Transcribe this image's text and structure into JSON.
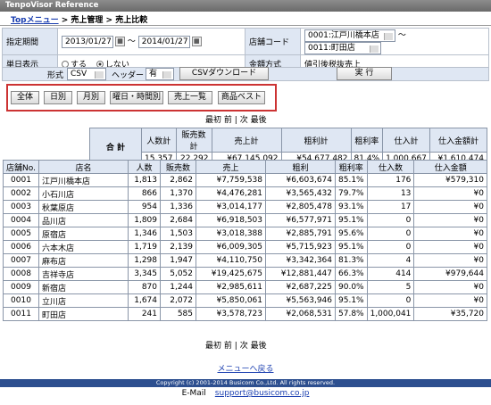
{
  "app_title": "TenpoVisor Reference",
  "breadcrumb": {
    "top": "Topメニュー",
    "sep1": " > ",
    "mid": "売上管理",
    "sep2": " > ",
    "current": "売上比較"
  },
  "form": {
    "period_label": "指定期間",
    "date_from": "2013/01/27",
    "tilde": "〜",
    "date_to": "2014/01/27",
    "store_label": "店舗コード",
    "store_from": "0001:江戸川橋本店",
    "store_to": "0011:町田店",
    "single_label": "単日表示",
    "radio_yes": "する",
    "radio_no": "しない",
    "amount_label": "金額方式",
    "amount_value": "値引後税抜売上"
  },
  "toolbar": {
    "format_label": "形式",
    "format_value": "CSV",
    "header_label": "ヘッダー",
    "header_value": "有",
    "csv_download": "CSVダウンロード",
    "run": "実 行"
  },
  "view_buttons": [
    "全体",
    "日別",
    "月別",
    "曜日・時間別",
    "売上一覧",
    "商品ベスト"
  ],
  "pager": {
    "first": "最初",
    "prev": "前",
    "sep": "|",
    "next": "次",
    "last": "最後"
  },
  "totals": {
    "label": "合 計",
    "headers": [
      "人数計",
      "販売数計",
      "売上計",
      "粗利計",
      "粗利率",
      "仕入計",
      "仕入金額計"
    ],
    "values": [
      "15,357",
      "22,292",
      "¥67,145,092",
      "¥54,677,482",
      "81.4%",
      "1,000,667",
      "¥1,610,474"
    ]
  },
  "table": {
    "headers": [
      "店舗No.",
      "店名",
      "人数",
      "販売数",
      "売上",
      "粗利",
      "粗利率",
      "仕入数",
      "仕入金額"
    ],
    "rows": [
      [
        "0001",
        "江戸川橋本店",
        "1,813",
        "2,862",
        "¥7,759,538",
        "¥6,603,674",
        "85.1%",
        "176",
        "¥579,310"
      ],
      [
        "0002",
        "小石川店",
        "866",
        "1,370",
        "¥4,476,281",
        "¥3,565,432",
        "79.7%",
        "13",
        "¥0"
      ],
      [
        "0003",
        "秋葉原店",
        "954",
        "1,336",
        "¥3,014,177",
        "¥2,805,478",
        "93.1%",
        "17",
        "¥0"
      ],
      [
        "0004",
        "品川店",
        "1,809",
        "2,684",
        "¥6,918,503",
        "¥6,577,971",
        "95.1%",
        "0",
        "¥0"
      ],
      [
        "0005",
        "原宿店",
        "1,346",
        "1,503",
        "¥3,018,388",
        "¥2,885,791",
        "95.6%",
        "0",
        "¥0"
      ],
      [
        "0006",
        "六本木店",
        "1,719",
        "2,139",
        "¥6,009,305",
        "¥5,715,923",
        "95.1%",
        "0",
        "¥0"
      ],
      [
        "0007",
        "麻布店",
        "1,298",
        "1,947",
        "¥4,110,750",
        "¥3,342,364",
        "81.3%",
        "4",
        "¥0"
      ],
      [
        "0008",
        "吉祥寺店",
        "3,345",
        "5,052",
        "¥19,425,675",
        "¥12,881,447",
        "66.3%",
        "414",
        "¥979,644"
      ],
      [
        "0009",
        "新宿店",
        "870",
        "1,244",
        "¥2,985,611",
        "¥2,687,225",
        "90.0%",
        "5",
        "¥0"
      ],
      [
        "0010",
        "立川店",
        "1,674",
        "2,072",
        "¥5,850,061",
        "¥5,563,946",
        "95.1%",
        "0",
        "¥0"
      ],
      [
        "0011",
        "町田店",
        "241",
        "585",
        "¥3,578,723",
        "¥2,068,531",
        "57.8%",
        "1,000,041",
        "¥35,720"
      ]
    ]
  },
  "back_link": "メニューへ戻る",
  "copyright": "Copyright (c) 2001-2014 Busicom Co.,Ltd. All rights reserved.",
  "email_label": "E-Mail",
  "email": "support@busicom.co.jp"
}
